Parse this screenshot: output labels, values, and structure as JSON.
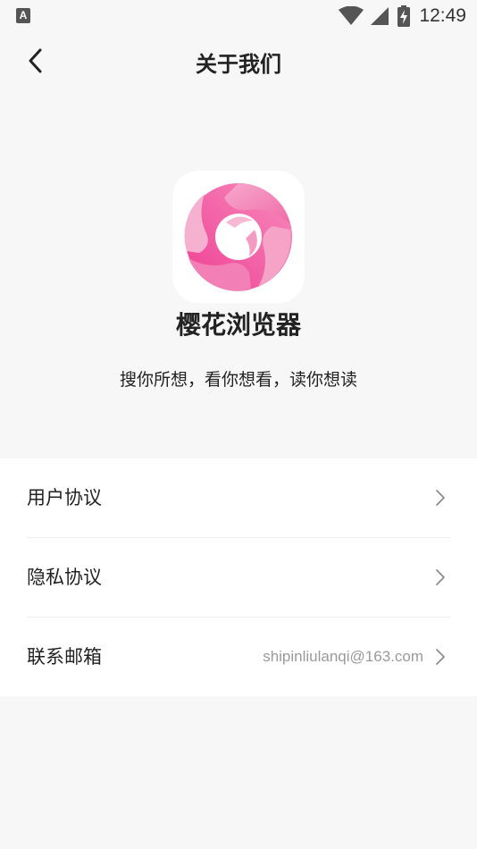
{
  "status_bar": {
    "left_icon_letter": "A",
    "time": "12:49",
    "icons": [
      "wifi-icon",
      "cell-signal-icon",
      "battery-charging-icon"
    ]
  },
  "header": {
    "title": "关于我们",
    "back_icon": "chevron-left-icon"
  },
  "app": {
    "logo_icon": "sakura-swirl-logo",
    "name": "樱花浏览器",
    "slogan": "搜你所想，看你想看，读你想读"
  },
  "menu": {
    "items": [
      {
        "label": "用户协议",
        "value": "",
        "icon": "chevron-right-icon"
      },
      {
        "label": "隐私协议",
        "value": "",
        "icon": "chevron-right-icon"
      },
      {
        "label": "联系邮箱",
        "value": "shipinliulanqi@163.com",
        "icon": "chevron-right-icon"
      }
    ]
  },
  "colors": {
    "background": "#f7f7f7",
    "card": "#ffffff",
    "logo_pink": "#f0509e",
    "logo_light_pink": "#f7a3c8",
    "secondary_text": "#9a9a9a"
  }
}
